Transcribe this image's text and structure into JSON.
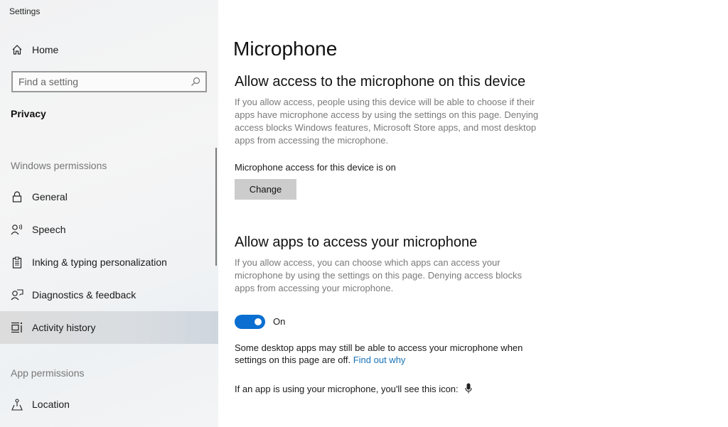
{
  "window": {
    "title": "Settings"
  },
  "sidebar": {
    "home_label": "Home",
    "search_placeholder": "Find a setting",
    "section_title": "Privacy",
    "groups": [
      {
        "header": "Windows permissions"
      },
      {
        "header": "App permissions"
      }
    ],
    "items": [
      {
        "label": "General",
        "icon": "lock-icon"
      },
      {
        "label": "Speech",
        "icon": "speech-icon"
      },
      {
        "label": "Inking & typing personalization",
        "icon": "clipboard-icon"
      },
      {
        "label": "Diagnostics & feedback",
        "icon": "feedback-icon"
      },
      {
        "label": "Activity history",
        "icon": "timeline-icon",
        "selected": true
      },
      {
        "label": "Location",
        "icon": "location-icon"
      }
    ]
  },
  "main": {
    "title": "Microphone",
    "device_section": {
      "heading": "Allow access to the microphone on this device",
      "description": "If you allow access, people using this device will be able to choose if their apps have microphone access by using the settings on this page. Denying access blocks Windows features, Microsoft Store apps, and most desktop apps from accessing the microphone.",
      "status": "Microphone access for this device is on",
      "button_label": "Change"
    },
    "apps_section": {
      "heading": "Allow apps to access your microphone",
      "description": "If you allow access, you can choose which apps can access your microphone by using the settings on this page. Denying access blocks apps from accessing your microphone.",
      "toggle_state": "On",
      "toggle_on": true,
      "note_text": "Some desktop apps may still be able to access your microphone when settings on this page are off.",
      "note_link": "Find out why",
      "icon_note": "If an app is using your microphone, you'll see this icon:"
    },
    "accent_color": "#0a6fd1",
    "link_color": "#1a73b8"
  }
}
